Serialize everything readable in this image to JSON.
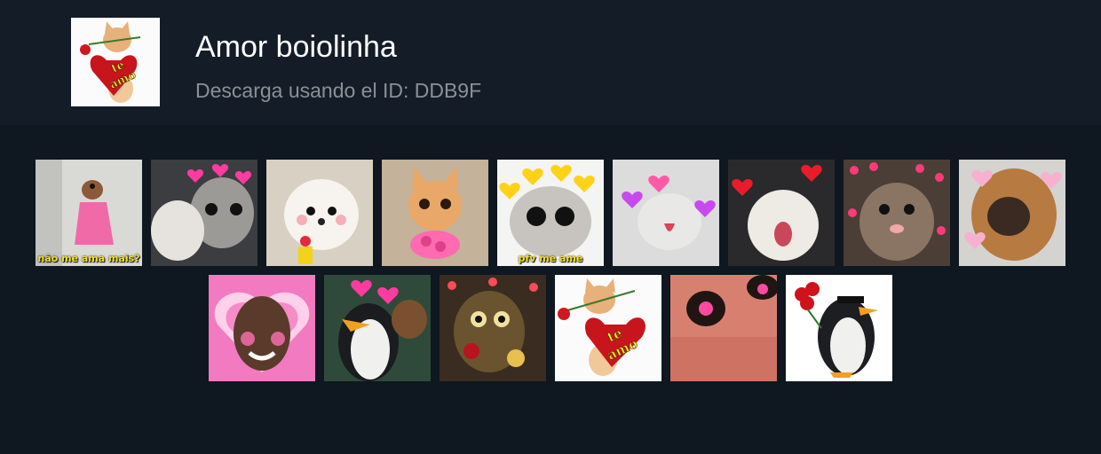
{
  "pack": {
    "title": "Amor boiolinha",
    "download_text": "Descarga usando el ID: DDB9F",
    "icon": "kitten-heart-te-amo"
  },
  "stickers": [
    {
      "name": "sticker-dog-pink-dress",
      "caption": "não me ama mais?"
    },
    {
      "name": "sticker-cat-hearts-paw"
    },
    {
      "name": "sticker-white-puppy-flower"
    },
    {
      "name": "sticker-kitten-roses"
    },
    {
      "name": "sticker-hamster-yellow-hearts",
      "caption": "pfv me ame"
    },
    {
      "name": "sticker-kitten-purple-hearts"
    },
    {
      "name": "sticker-cat-red-hearts"
    },
    {
      "name": "sticker-hamster-hearts"
    },
    {
      "name": "sticker-dog-nose-hearts"
    },
    {
      "name": "sticker-cj-pink-hearts"
    },
    {
      "name": "sticker-penguin-hearts"
    },
    {
      "name": "sticker-monkey-rose"
    },
    {
      "name": "sticker-kitten-te-amo",
      "heart_text": [
        "te",
        "amo"
      ]
    },
    {
      "name": "sticker-eye-closeup-hearts"
    },
    {
      "name": "sticker-penguin-roses"
    }
  ],
  "icon_heart_text": [
    "te",
    "amo"
  ]
}
